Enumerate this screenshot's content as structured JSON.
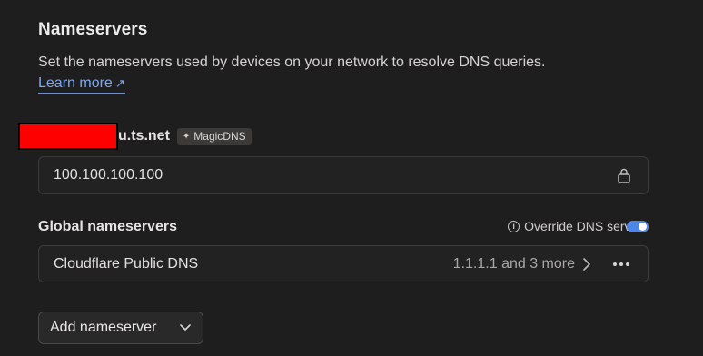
{
  "section": {
    "title": "Nameservers",
    "description": "Set the nameservers used by devices on your network to resolve DNS queries.",
    "learn_more": "Learn more",
    "learn_more_icon": "external-arrow-icon"
  },
  "tailnet": {
    "name_suffix": "u.ts.net",
    "badge": "MagicDNS",
    "badge_icon": "sparkle-icon",
    "nameserver_value": "100.100.100.100",
    "lock_icon": "lock-icon"
  },
  "global": {
    "label": "Global nameservers",
    "override_label": "Override DNS servers",
    "override_enabled": true,
    "toggle_color": "#4f86e6",
    "entries": [
      {
        "name": "Cloudflare Public DNS",
        "summary": "1.1.1.1 and 3 more"
      }
    ]
  },
  "actions": {
    "add_nameserver": "Add nameserver"
  },
  "colors": {
    "background": "#1f1e1e",
    "link": "#7ea9f2",
    "redaction": "#ff0000"
  }
}
